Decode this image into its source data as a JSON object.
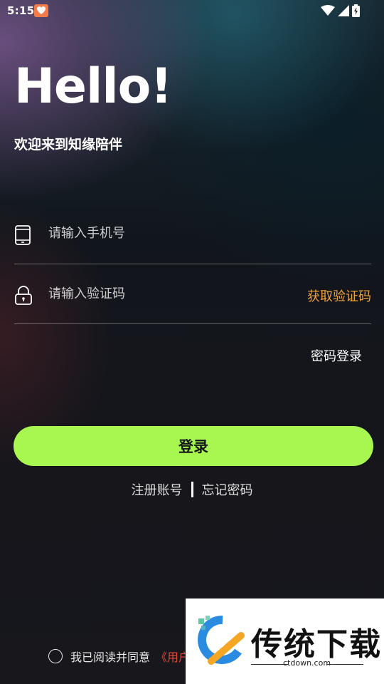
{
  "status_bar": {
    "time": "5:15"
  },
  "header": {
    "title": "Hello!",
    "subtitle": "欢迎来到知缘陪伴"
  },
  "form": {
    "phone_placeholder": "请输入手机号",
    "code_placeholder": "请输入验证码",
    "get_code_label": "获取验证码",
    "password_login_label": "密码登录",
    "login_button": "登录"
  },
  "links": {
    "register": "注册账号",
    "forgot": "忘记密码"
  },
  "agreement": {
    "text": "我已阅读并同意",
    "link": "《用户"
  },
  "watermark": {
    "title": "传统下载",
    "url": "ctdown.com"
  },
  "colors": {
    "accent": "#a8f750",
    "link_orange": "#f0a23a",
    "link_red": "#e5483c"
  }
}
